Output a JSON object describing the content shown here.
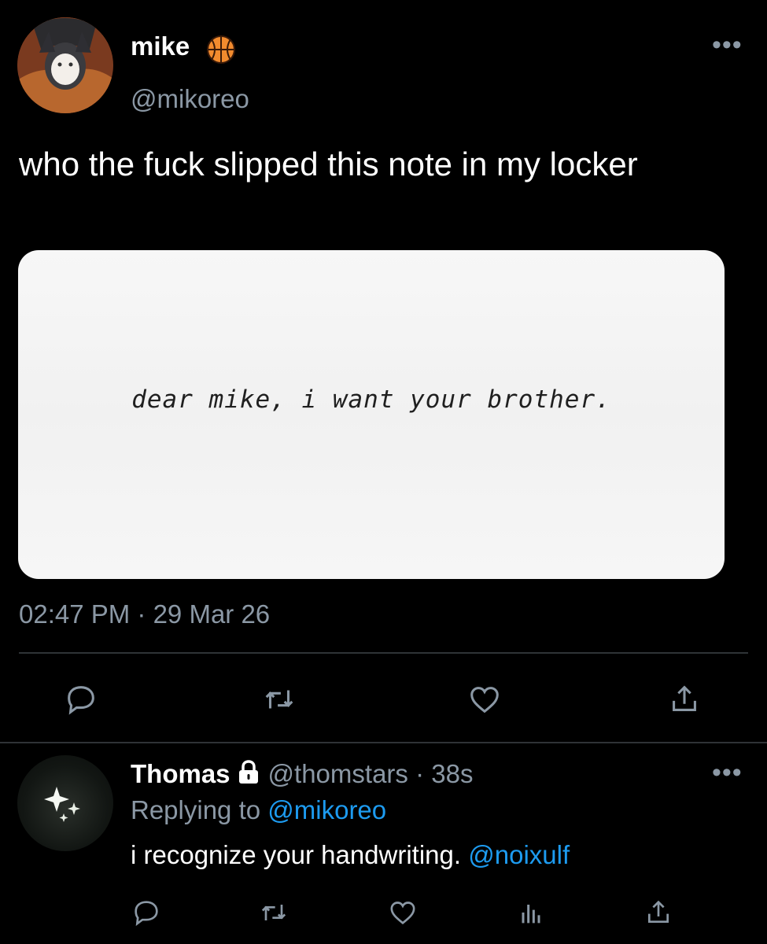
{
  "tweet": {
    "author_name": "mike",
    "author_emoji": "🏀",
    "handle": "@mikoreo",
    "text": "who the fuck slipped this note in my locker",
    "image_text": "dear mike, i want your brother.",
    "time": "02:47 PM",
    "separator": " · ",
    "date": "29 Mar 26",
    "more_label": "•••"
  },
  "actions": [
    "reply-icon",
    "retweet-icon",
    "like-icon",
    "share-icon"
  ],
  "reply": {
    "author_name": "Thomas",
    "handle": "@thomstars",
    "age": "38s",
    "separator": " · ",
    "replying_prefix": "Replying to ",
    "replying_handle": "@mikoreo",
    "text": "i recognize your handwriting. ",
    "mention": "@noixulf",
    "more_label": "•••",
    "actions": [
      "reply-icon",
      "retweet-icon",
      "like-icon",
      "analytics-icon",
      "share-icon"
    ]
  },
  "colors": {
    "background": "#000000",
    "text": "#ffffff",
    "muted": "#8b98a5",
    "link": "#1d9bf0",
    "divider": "#2f3336"
  }
}
